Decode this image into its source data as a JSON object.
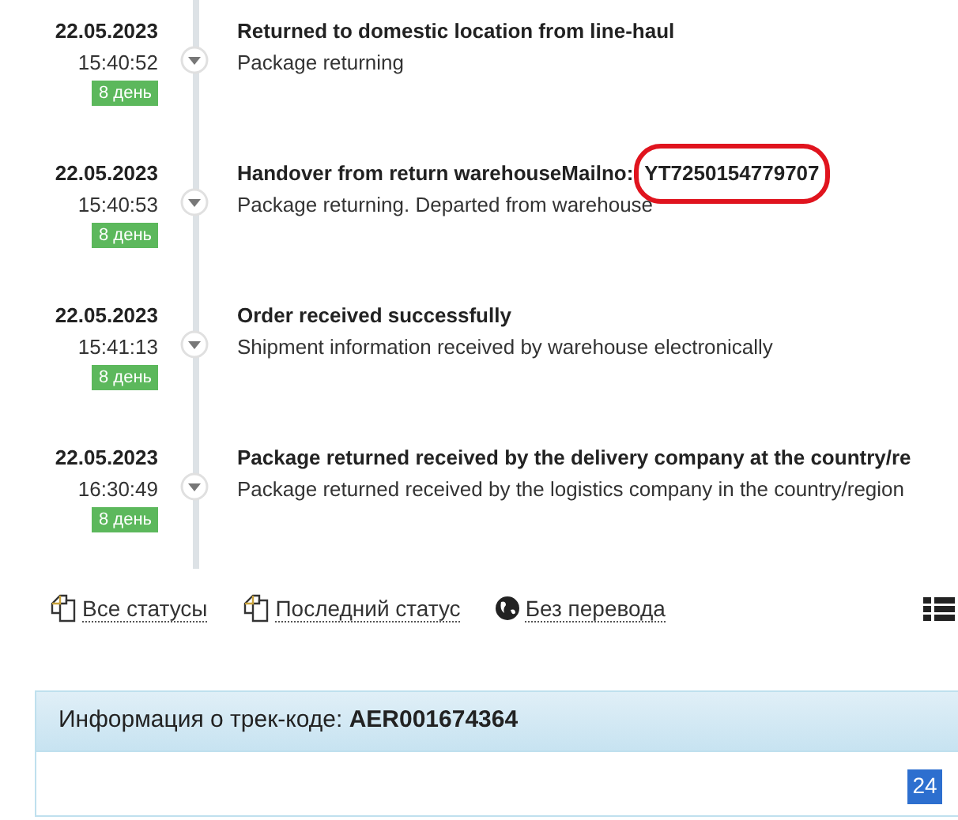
{
  "events": [
    {
      "date": "22.05.2023",
      "time": "15:40:52",
      "days": "8 день",
      "title": "Returned to domestic location from line-haul",
      "detail": "Package returning"
    },
    {
      "date": "22.05.2023",
      "time": "15:40:53",
      "days": "8 день",
      "title": "Handover from return warehouseMailno:",
      "code": "YT7250154779707",
      "circled": true,
      "detail": "Package returning. Departed from warehouse"
    },
    {
      "date": "22.05.2023",
      "time": "15:41:13",
      "days": "8 день",
      "title": "Order received successfully",
      "detail": "Shipment information received by warehouse electronically"
    },
    {
      "date": "22.05.2023",
      "time": "16:30:49",
      "days": "8 день",
      "title": "Package returned received by the delivery company at the country/re",
      "detail": "Package returned received by the logistics company in the country/region"
    }
  ],
  "links": [
    {
      "kind": "copy",
      "label": "Все статусы"
    },
    {
      "kind": "copy",
      "label": "Последний статус"
    },
    {
      "kind": "globe",
      "label": "Без перевода"
    }
  ],
  "info_panel": {
    "label": "Информация о трек-коде:",
    "code": "AER001674364"
  },
  "badge": "24"
}
